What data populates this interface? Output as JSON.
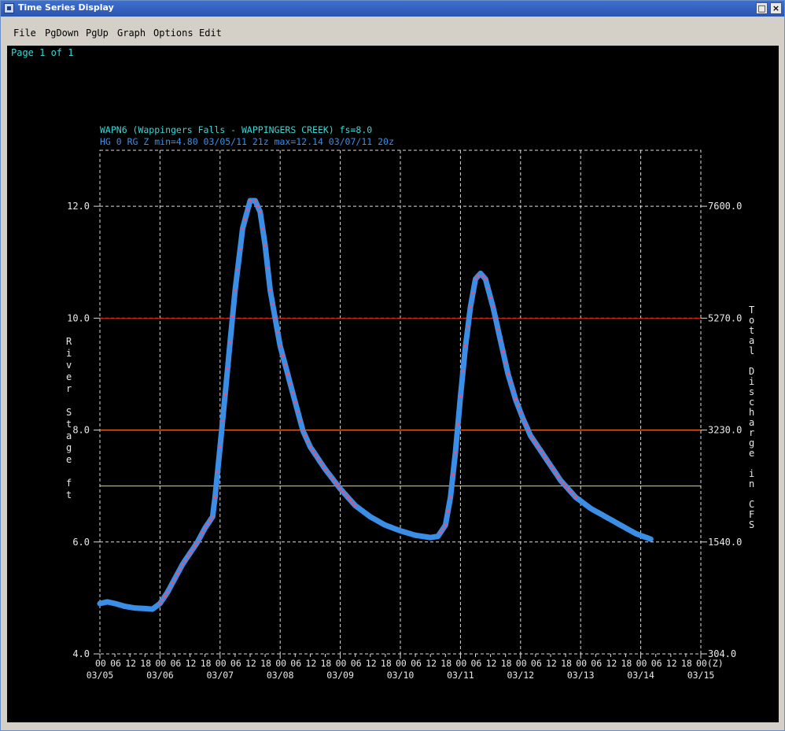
{
  "window": {
    "title": "Time Series Display"
  },
  "menu": [
    "File",
    "PgDown",
    "PgUp",
    "Graph",
    "Options",
    "Edit"
  ],
  "page_label": "Page 1 of 1",
  "chart_data": {
    "type": "line",
    "title": "WAPN6 (Wappingers Falls - WAPPINGERS CREEK) fs=8.0",
    "subtitle": "HG 0 RG Z min=4.80 03/05/11 21z max=12.14 03/07/11 20z",
    "ylabel": "River Stage ft",
    "y2label": "Total Discharge in CFS",
    "ylim": [
      4.0,
      13.0
    ],
    "yticks": [
      {
        "value": 4.0,
        "label": "4.0",
        "right": "304.0"
      },
      {
        "value": 6.0,
        "label": "6.0",
        "right": "1540.0"
      },
      {
        "value": 8.0,
        "label": "8.0",
        "right": "3230.0"
      },
      {
        "value": 10.0,
        "label": "10.0",
        "right": "5270.0"
      },
      {
        "value": 12.0,
        "label": "12.0",
        "right": "7600.0"
      }
    ],
    "xlim_hours": [
      0,
      240
    ],
    "hour_ticks": [
      "00",
      "06",
      "12",
      "18"
    ],
    "dates": [
      "03/05",
      "03/06",
      "03/07",
      "03/08",
      "03/09",
      "03/10",
      "03/11",
      "03/12",
      "03/13",
      "03/14",
      "03/15"
    ],
    "x_end_label": "00(Z)",
    "threshold_lines": [
      {
        "value": 10.0,
        "color": "#d21a1a"
      },
      {
        "value": 8.0,
        "color": "#ff7a1a"
      },
      {
        "value": 7.0,
        "color": "#e8e814"
      }
    ],
    "series": [
      {
        "color": "#3a8ee6",
        "marker_color": "#ff4a6a",
        "points": [
          [
            0,
            4.9
          ],
          [
            3,
            4.93
          ],
          [
            6,
            4.9
          ],
          [
            10,
            4.85
          ],
          [
            14,
            4.82
          ],
          [
            18,
            4.81
          ],
          [
            21,
            4.8
          ],
          [
            24,
            4.9
          ],
          [
            27,
            5.1
          ],
          [
            30,
            5.35
          ],
          [
            33,
            5.6
          ],
          [
            36,
            5.8
          ],
          [
            39,
            6.0
          ],
          [
            42,
            6.25
          ],
          [
            45,
            6.45
          ],
          [
            46,
            6.8
          ],
          [
            48,
            7.7
          ],
          [
            51,
            9.1
          ],
          [
            54,
            10.5
          ],
          [
            57,
            11.6
          ],
          [
            60,
            12.1
          ],
          [
            62,
            12.1
          ],
          [
            64,
            11.9
          ],
          [
            66,
            11.3
          ],
          [
            68,
            10.5
          ],
          [
            70,
            10.0
          ],
          [
            72,
            9.5
          ],
          [
            75,
            9.0
          ],
          [
            78,
            8.5
          ],
          [
            81,
            8.0
          ],
          [
            84,
            7.7
          ],
          [
            90,
            7.3
          ],
          [
            96,
            6.95
          ],
          [
            102,
            6.65
          ],
          [
            108,
            6.45
          ],
          [
            114,
            6.3
          ],
          [
            120,
            6.2
          ],
          [
            126,
            6.12
          ],
          [
            132,
            6.08
          ],
          [
            135,
            6.1
          ],
          [
            138,
            6.3
          ],
          [
            140,
            6.8
          ],
          [
            142,
            7.6
          ],
          [
            144,
            8.6
          ],
          [
            146,
            9.5
          ],
          [
            148,
            10.2
          ],
          [
            150,
            10.7
          ],
          [
            152,
            10.8
          ],
          [
            154,
            10.7
          ],
          [
            157,
            10.2
          ],
          [
            160,
            9.6
          ],
          [
            163,
            9.0
          ],
          [
            166,
            8.55
          ],
          [
            169,
            8.2
          ],
          [
            172,
            7.9
          ],
          [
            178,
            7.5
          ],
          [
            184,
            7.1
          ],
          [
            190,
            6.8
          ],
          [
            196,
            6.6
          ],
          [
            202,
            6.45
          ],
          [
            208,
            6.3
          ],
          [
            214,
            6.15
          ],
          [
            220,
            6.05
          ]
        ]
      }
    ],
    "series_xlim": [
      0,
      220
    ]
  }
}
